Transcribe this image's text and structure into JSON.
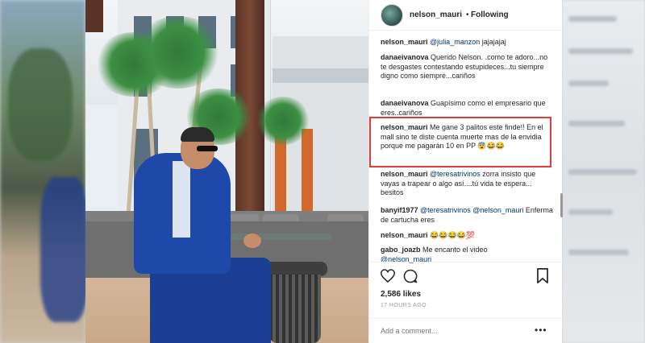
{
  "header": {
    "username": "nelson_mauri",
    "separator": "•",
    "follow_status": "Following"
  },
  "comments": [
    {
      "user": "nelson_mauri",
      "mention": "@julia_manzon",
      "text": " jajajajaj"
    },
    {
      "user": "danaeivanova",
      "text": " Querido Nelson. .como te adoro...no te desgastes contestando estupideces...tu siempre digno como siempre...cariños"
    },
    {
      "user": "danaeivanova",
      "text": " Guapísimo como el empresario que eres..cariños"
    },
    {
      "user": "nelson_mauri",
      "text": " Me gane 3 palitos este finde!! En el mall sino te diste cuenta muerte mas de la envidia porque me pagarán 10 en PP 😨😂😂"
    },
    {
      "user": "nelson_mauri",
      "mention": "@teresatrivinos",
      "text": " zorra insisto que vayas a trapear o algo así....tú vida te espera... besitos"
    },
    {
      "user": "banyif1977",
      "mention": "@teresatrivinos @nelson_mauri",
      "text": " Enferma de cartucha eres"
    },
    {
      "user": "nelson_mauri",
      "text": " 😂😂😂😂💯"
    },
    {
      "user": "gabo_joazb",
      "text": " Me encanto el video",
      "trailing_mention": "@nelson_mauri"
    }
  ],
  "actions": {
    "likes": "2,586 likes",
    "time_ago": "17 HOURS AGO",
    "add_comment_placeholder": "Add a comment...",
    "more": "•••"
  },
  "colors": {
    "highlight_border": "#e23b3b",
    "mention": "#003569",
    "jacket": "#1f49a8"
  },
  "icons": [
    "heart-icon",
    "comment-icon",
    "bookmark-icon",
    "more-options-icon"
  ]
}
